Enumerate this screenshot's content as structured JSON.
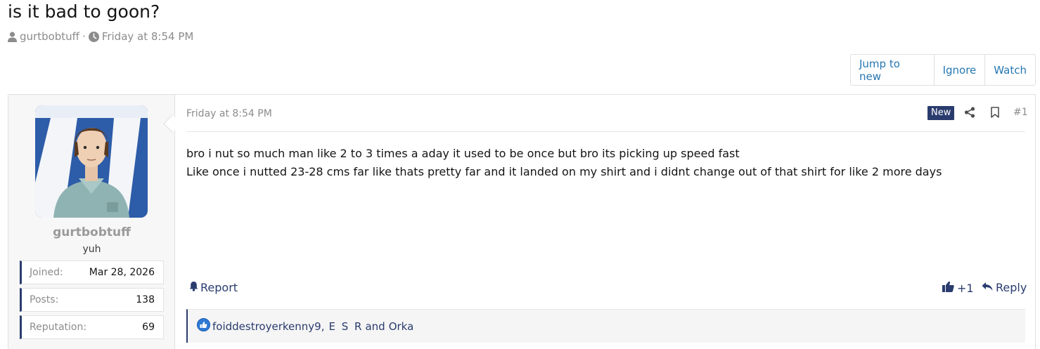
{
  "thread": {
    "title": "is it bad to goon?",
    "author": "gurtbobtuff",
    "separator": "·",
    "posted": "Friday at 8:54 PM"
  },
  "actions": {
    "jump_to_new": "Jump to new",
    "ignore": "Ignore",
    "watch": "Watch"
  },
  "user": {
    "name": "gurtbobtuff",
    "title": "yuh",
    "stats": [
      {
        "label": "Joined:",
        "value": "Mar 28, 2026"
      },
      {
        "label": "Posts:",
        "value": "138"
      },
      {
        "label": "Reputation:",
        "value": "69"
      }
    ]
  },
  "post": {
    "time": "Friday at 8:54 PM",
    "badge": "New",
    "number": "#1",
    "lines": [
      "bro i nut so much man like 2 to 3 times a aday it used to be once but bro its picking up speed fast",
      "Like once i nutted 23-28 cms far like thats pretty far and it landed on my shirt and i didnt change out of that shirt for like 2 more days"
    ],
    "report": "Report",
    "like_count": "+1",
    "reply": "Reply"
  },
  "reactions": {
    "user1": "foiddestroyerkenny9",
    "comma": ",",
    "user2": "E S R",
    "and": "and",
    "user3": "Orka"
  },
  "colors": {
    "accent": "#2a3c6e",
    "link": "#2577b1",
    "muted": "#8c8c8c"
  },
  "icons": [
    "user-icon",
    "clock-icon",
    "share-icon",
    "bookmark-icon",
    "bell-icon",
    "thumbs-up-icon",
    "reply-icon",
    "like-reaction-icon"
  ]
}
